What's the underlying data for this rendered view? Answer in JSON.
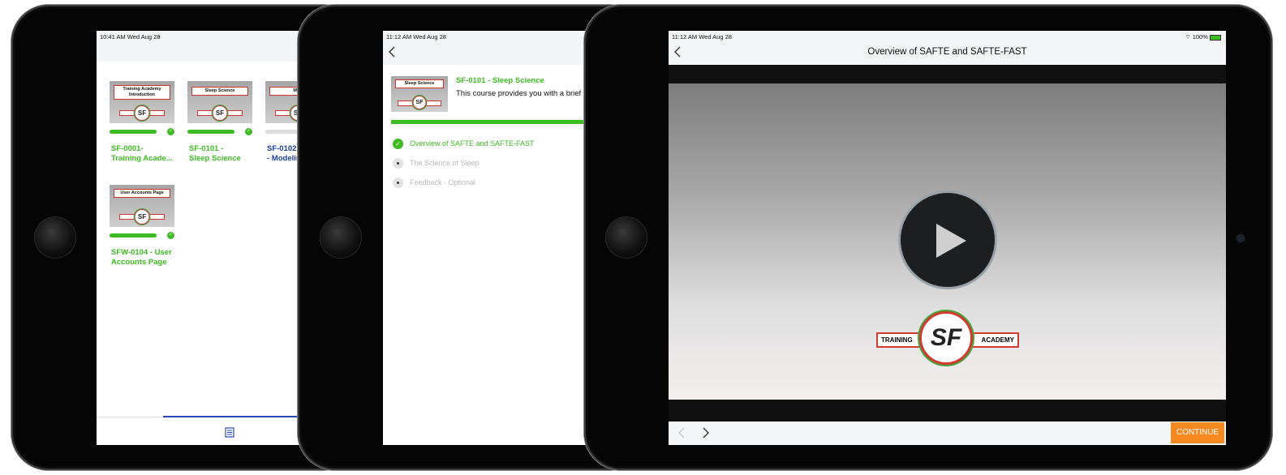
{
  "ipad1": {
    "status": "10:41 AM  Wed Aug 28",
    "courses": [
      {
        "thumb_title": "Training Academy Introduction",
        "label_l1": "SF-0001-",
        "label_l2": "Training Acade...",
        "progress": 1.0,
        "complete": true,
        "label_color": "#3dbb22"
      },
      {
        "thumb_title": "Sleep Science",
        "label_l1": "SF-0101 -",
        "label_l2": "Sleep Science",
        "progress": 1.0,
        "complete": true,
        "label_color": "#3dbb22"
      },
      {
        "thumb_title": "Mod",
        "label_l1": "SF-0102",
        "label_l2": "- Modelin",
        "progress": 0.0,
        "complete": false,
        "label_color": "#1a3e9c"
      },
      {
        "thumb_title": "User Accounts Page",
        "label_l1": "SFW-0104 - User",
        "label_l2": "Accounts Page",
        "progress": 1.0,
        "complete": true,
        "label_color": "#3dbb22"
      }
    ],
    "tab_icon": "book-icon"
  },
  "ipad2": {
    "status": "11:12 AM  Wed Aug 28",
    "course_title": "SF-0101 - Sleep Science",
    "course_desc": "This course provides you with a brief h",
    "thumb_title": "Sleep Science",
    "progress": 1.0,
    "lessons": [
      {
        "label": "Overview of SAFTE and SAFTE-FAST",
        "done": true
      },
      {
        "label": "The Science of Sleep",
        "done": false
      },
      {
        "label": "Feedback - Optional",
        "done": false
      }
    ]
  },
  "ipad3": {
    "status_left": "11:12 AM  Wed Aug 28",
    "status_right": "100%",
    "title": "Overview of SAFTE and SAFTE-FAST",
    "logo_left": "Training",
    "logo_mid": "SF",
    "logo_right": "Academy",
    "continue_label": "CONTINUE",
    "accent": "#f5891f"
  }
}
